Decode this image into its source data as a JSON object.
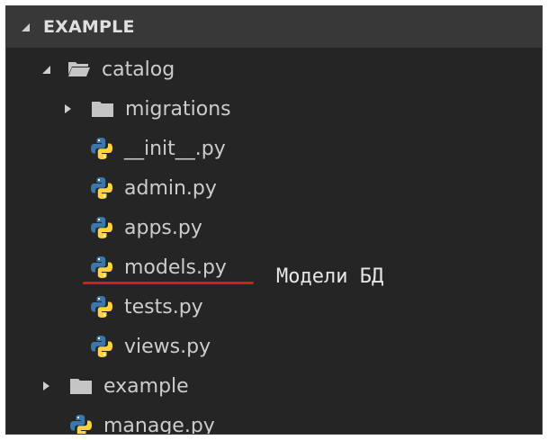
{
  "explorer": {
    "section_title": "EXAMPLE",
    "items": [
      {
        "label": "catalog",
        "kind": "folder-open"
      },
      {
        "label": "migrations",
        "kind": "folder"
      },
      {
        "label": "__init__.py",
        "kind": "python"
      },
      {
        "label": "admin.py",
        "kind": "python"
      },
      {
        "label": "apps.py",
        "kind": "python"
      },
      {
        "label": "models.py",
        "kind": "python"
      },
      {
        "label": "tests.py",
        "kind": "python"
      },
      {
        "label": "views.py",
        "kind": "python"
      },
      {
        "label": "example",
        "kind": "folder"
      },
      {
        "label": "manage.py",
        "kind": "python"
      }
    ]
  },
  "annotation": {
    "text": "Модели БД",
    "underline_color": "#c8231b"
  },
  "colors": {
    "panel_bg": "#252526",
    "header_bg": "#383838",
    "text": "#cccccc",
    "folder": "#c5c5c5",
    "python_blue": "#3b77a8",
    "python_yellow": "#ffd43b"
  },
  "icons": {
    "open_twisty": "triangle-down-right-icon",
    "closed_twisty": "triangle-right-icon",
    "folder": "folder-icon",
    "open_folder": "folder-open-icon",
    "python": "python-icon"
  }
}
